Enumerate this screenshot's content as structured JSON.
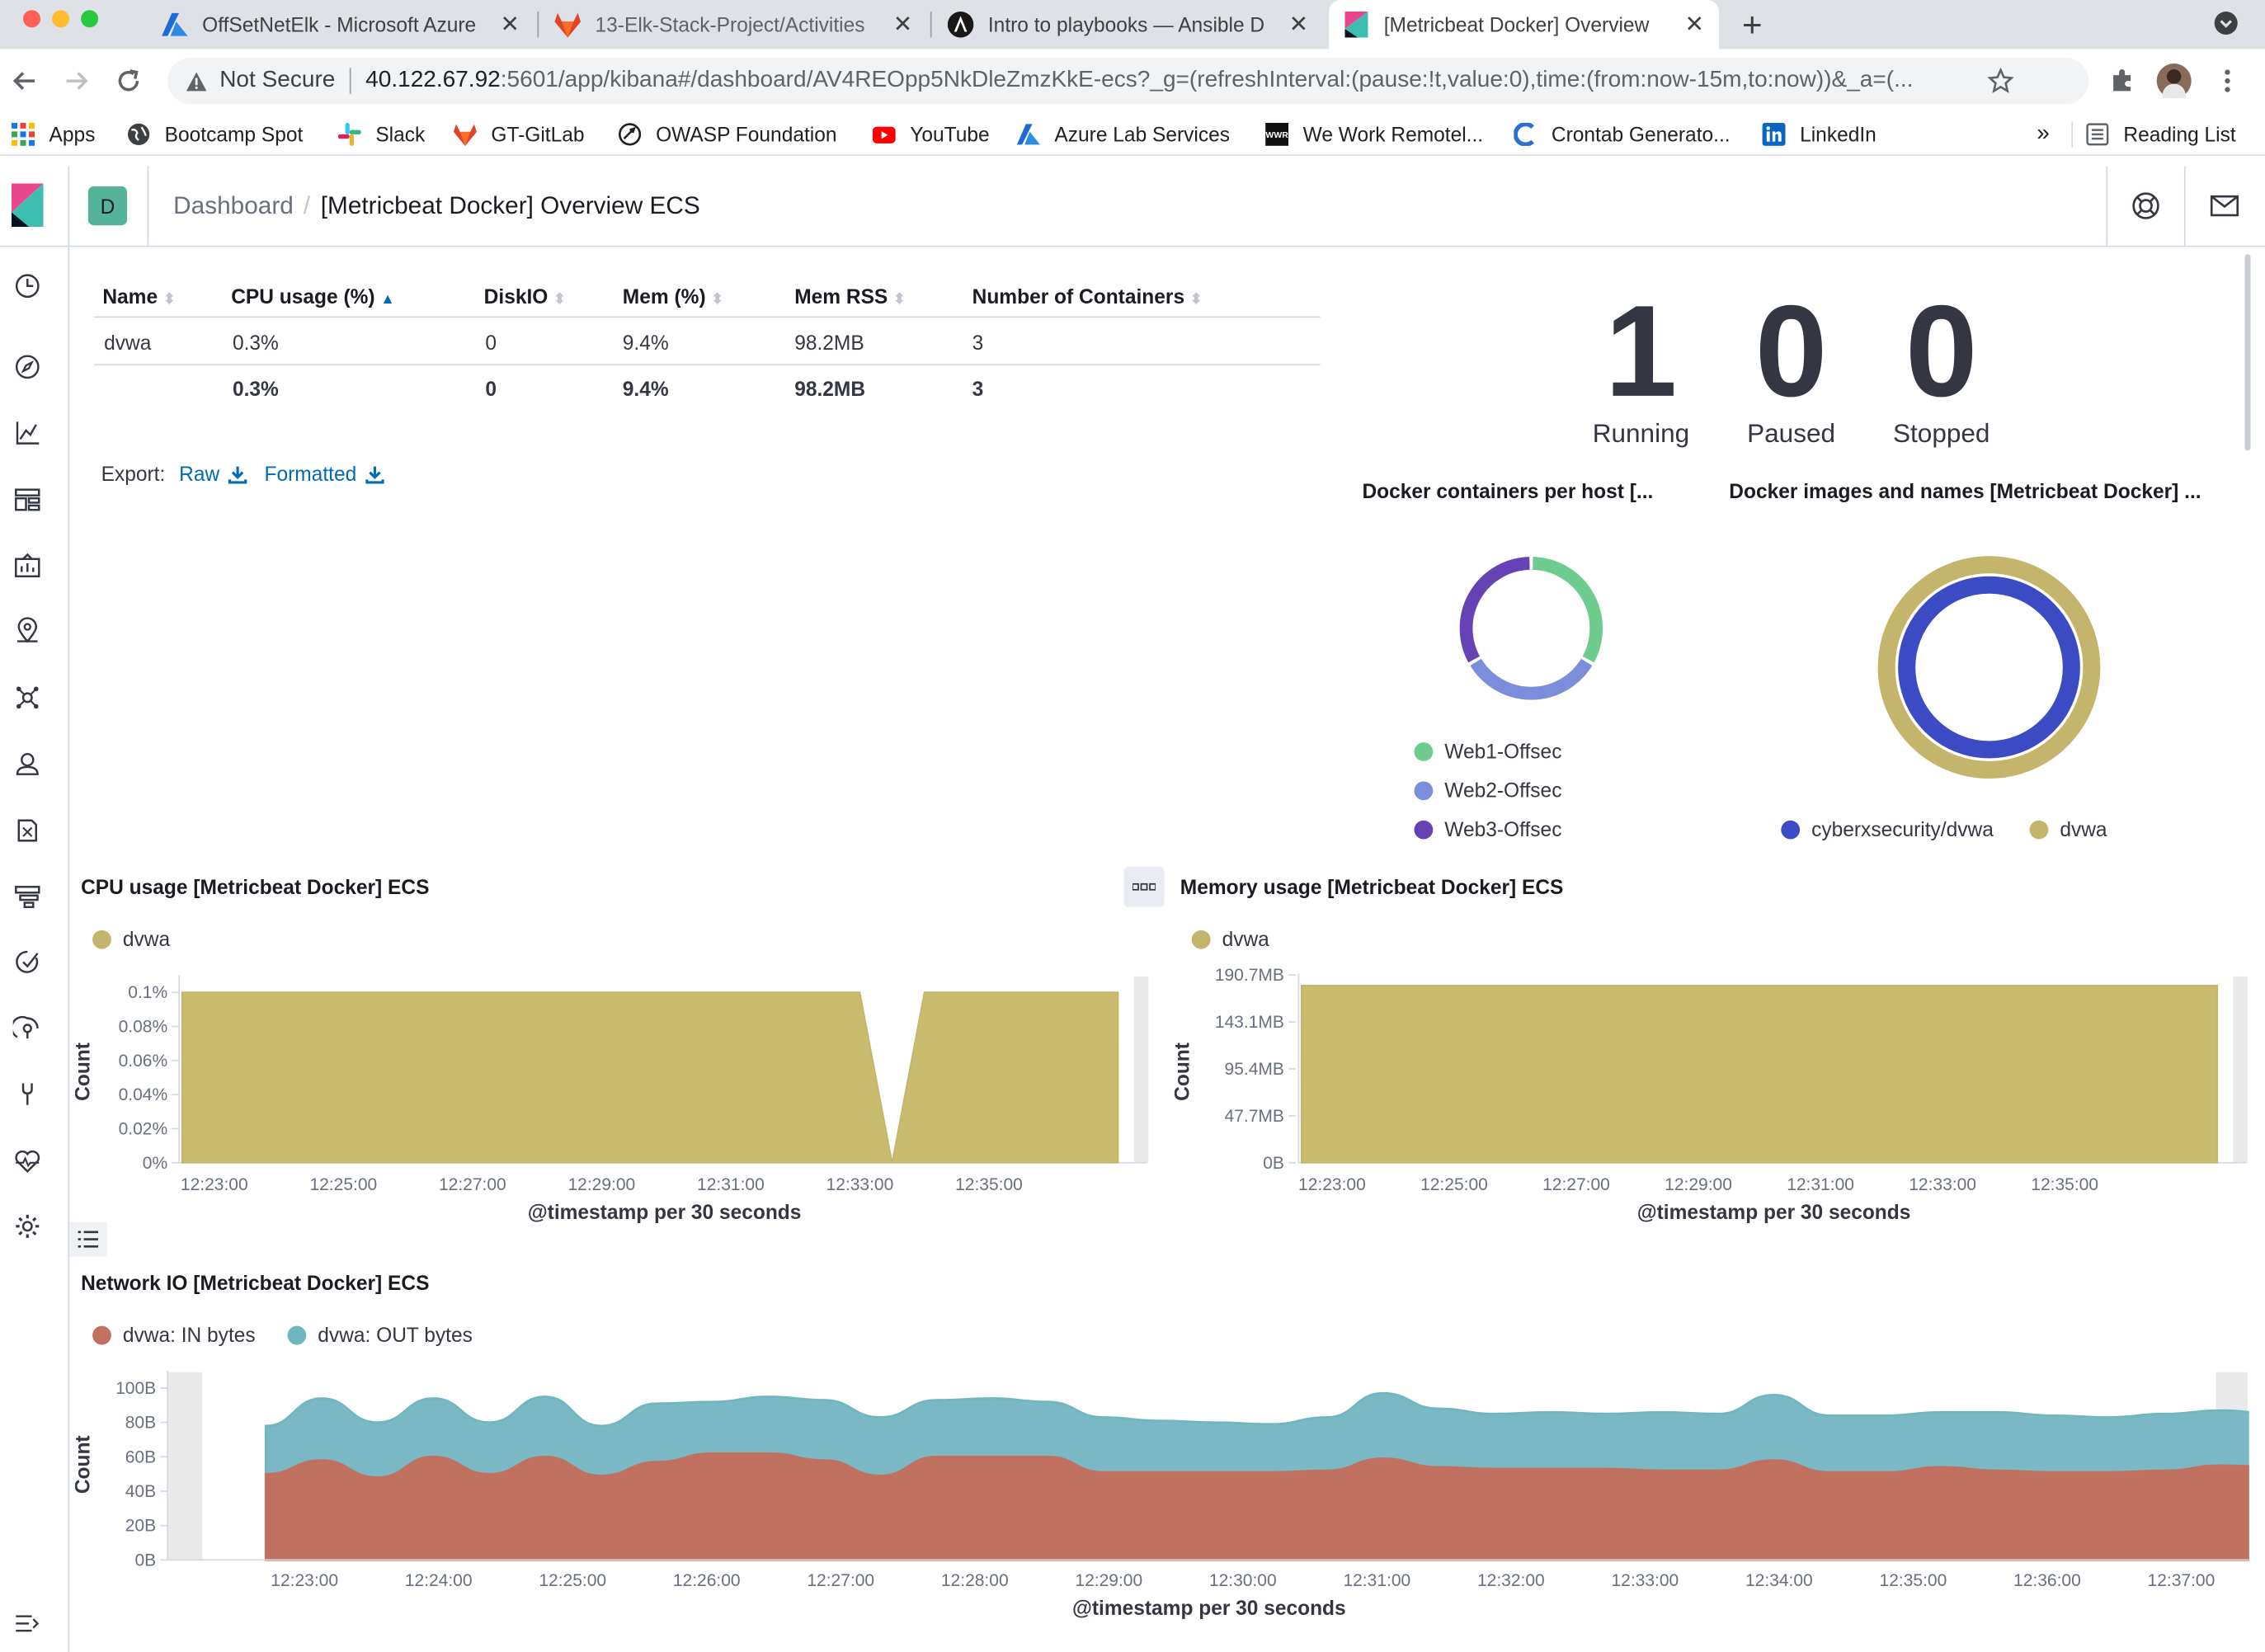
{
  "browser": {
    "tabs": [
      {
        "title": "OffSetNetElk - Microsoft Azure",
        "icon": "azure-icon"
      },
      {
        "title": "13-Elk-Stack-Project/Activities",
        "icon": "gitlab-icon"
      },
      {
        "title": "Intro to playbooks — Ansible D",
        "icon": "ansible-icon"
      },
      {
        "title": "[Metricbeat Docker] Overview",
        "icon": "kibana-icon"
      }
    ],
    "security_label": "Not Secure",
    "url_host": "40.122.67.92",
    "url_rest": ":5601/app/kibana#/dashboard/AV4REOpp5NkDleZmzKkE-ecs?_g=(refreshInterval:(pause:!t,value:0),time:(from:now-15m,to:now))&_a=(...",
    "bookmarks": [
      "Apps",
      "Bootcamp Spot",
      "Slack",
      "GT-GitLab",
      "OWASP Foundation",
      "YouTube",
      "Azure Lab Services",
      "We Work Remotel...",
      "Crontab Generato...",
      "LinkedIn"
    ],
    "overflow": "»",
    "reading_list": "Reading List"
  },
  "kibana": {
    "space_letter": "D",
    "breadcrumb_root": "Dashboard",
    "breadcrumb_sep": "/",
    "breadcrumb_current": "[Metricbeat Docker] Overview ECS"
  },
  "table": {
    "headers": [
      "Name",
      "CPU usage (%)",
      "DiskIO",
      "Mem (%)",
      "Mem RSS",
      "Number of Containers"
    ],
    "row": [
      "dvwa",
      "0.3%",
      "0",
      "9.4%",
      "98.2MB",
      "3"
    ],
    "totals": [
      "",
      "0.3%",
      "0",
      "9.4%",
      "98.2MB",
      "3"
    ],
    "export_label": "Export:",
    "raw_label": "Raw",
    "formatted_label": "Formatted"
  },
  "status": [
    {
      "value": "1",
      "label": "Running"
    },
    {
      "value": "0",
      "label": "Paused"
    },
    {
      "value": "0",
      "label": "Stopped"
    }
  ],
  "colors": {
    "green": "#6dcc8e",
    "blue": "#7b8edb",
    "purple": "#6543b5",
    "olive": "#c4b56c",
    "navy": "#3b4bc4",
    "red": "#c2705f",
    "teal": "#6fb5c2"
  },
  "chart_data": [
    {
      "type": "pie",
      "title": "Docker containers per host [...",
      "labels": [
        "Web1-Offsec",
        "Web2-Offsec",
        "Web3-Offsec"
      ],
      "values": [
        1,
        1,
        1
      ]
    },
    {
      "type": "pie",
      "title": "Docker images and names [Metricbeat Docker] ...",
      "labels": [
        "cyberxsecurity/dvwa",
        "dvwa"
      ],
      "values": [
        1,
        1
      ]
    },
    {
      "type": "area",
      "title": "CPU usage [Metricbeat Docker] ECS",
      "xlabel": "@timestamp per 30 seconds",
      "ylabel": "Count",
      "x_ticks": [
        "12:23:00",
        "12:25:00",
        "12:27:00",
        "12:29:00",
        "12:31:00",
        "12:33:00",
        "12:35:00"
      ],
      "y_ticks": [
        "0%",
        "0.02%",
        "0.04%",
        "0.06%",
        "0.08%",
        "0.1%"
      ],
      "ylim": [
        0,
        0.1
      ],
      "series": [
        {
          "name": "dvwa",
          "x": [
            "12:22:30",
            "12:33:00",
            "12:33:30",
            "12:34:00",
            "12:37:00"
          ],
          "values": [
            0.1,
            0.1,
            0,
            0.1,
            0.1
          ]
        }
      ]
    },
    {
      "type": "area",
      "title": "Memory usage [Metricbeat Docker] ECS",
      "xlabel": "@timestamp per 30 seconds",
      "ylabel": "Count",
      "x_ticks": [
        "12:23:00",
        "12:25:00",
        "12:27:00",
        "12:29:00",
        "12:31:00",
        "12:33:00",
        "12:35:00"
      ],
      "y_ticks": [
        "0B",
        "47.7MB",
        "95.4MB",
        "143.1MB",
        "190.7MB"
      ],
      "series": [
        {
          "name": "dvwa",
          "x": [
            "12:22:30",
            "12:37:30"
          ],
          "values": [
            "180MB",
            "180MB"
          ]
        }
      ]
    },
    {
      "type": "area",
      "title": "Network IO [Metricbeat Docker] ECS",
      "xlabel": "@timestamp per 30 seconds",
      "ylabel": "Count",
      "x_ticks": [
        "12:23:00",
        "12:24:00",
        "12:25:00",
        "12:26:00",
        "12:27:00",
        "12:28:00",
        "12:29:00",
        "12:30:00",
        "12:31:00",
        "12:32:00",
        "12:33:00",
        "12:34:00",
        "12:35:00",
        "12:36:00",
        "12:37:00"
      ],
      "y_ticks": [
        "0B",
        "20B",
        "40B",
        "60B",
        "80B",
        "100B"
      ],
      "ylim": [
        0,
        100
      ],
      "stacked": true,
      "series": [
        {
          "name": "dvwa: IN bytes",
          "values": [
            50,
            58,
            48,
            60,
            50,
            60,
            49,
            57,
            62,
            62,
            58,
            49,
            60,
            60,
            60,
            51,
            51,
            51,
            51,
            52,
            59,
            54,
            53,
            53,
            53,
            52,
            52,
            58,
            51,
            51,
            54,
            52,
            51,
            51,
            52,
            55,
            54
          ]
        },
        {
          "name": "dvwa: OUT bytes",
          "values": [
            28,
            36,
            32,
            34,
            30,
            35,
            29,
            34,
            30,
            33,
            35,
            34,
            33,
            34,
            32,
            32,
            30,
            29,
            28,
            31,
            38,
            34,
            32,
            33,
            32,
            34,
            33,
            38,
            33,
            33,
            32,
            34,
            33,
            32,
            33,
            32,
            31
          ]
        }
      ]
    }
  ]
}
